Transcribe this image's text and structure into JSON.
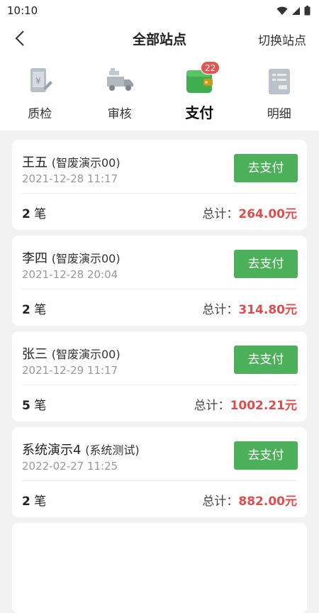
{
  "status_bar": {
    "time": "10:10"
  },
  "nav": {
    "title": "全部站点",
    "switch_label": "切换站点"
  },
  "tabs": [
    {
      "label": "质检",
      "icon": "quality-check-icon"
    },
    {
      "label": "审核",
      "icon": "truck-review-icon"
    },
    {
      "label": "支付",
      "icon": "wallet-icon",
      "badge": "22",
      "active": true
    },
    {
      "label": "明细",
      "icon": "detail-doc-icon"
    }
  ],
  "cards": [
    {
      "name": "王五",
      "site": "(智废演示00)",
      "time": "2021-12-28 11:17",
      "button": "去支付",
      "count_num": "2",
      "count_unit": "笔",
      "total_label": "总计：",
      "amount": "264.00",
      "unit": "元"
    },
    {
      "name": "李四",
      "site": "(智废演示00)",
      "time": "2021-12-28 20:04",
      "button": "去支付",
      "count_num": "2",
      "count_unit": "笔",
      "total_label": "总计：",
      "amount": "314.80",
      "unit": "元"
    },
    {
      "name": "张三",
      "site": "(智废演示00)",
      "time": "2021-12-29 11:17",
      "button": "去支付",
      "count_num": "5",
      "count_unit": "笔",
      "total_label": "总计：",
      "amount": "1002.21",
      "unit": "元"
    },
    {
      "name": "系统演示4",
      "site": "(系统测试)",
      "time": "2022-02-27 11:25",
      "button": "去支付",
      "count_num": "2",
      "count_unit": "笔",
      "total_label": "总计：",
      "amount": "882.00",
      "unit": "元"
    }
  ],
  "colors": {
    "accent_green": "#4caf5a",
    "amount_red": "#e04d4d",
    "badge_red": "#e25555"
  }
}
